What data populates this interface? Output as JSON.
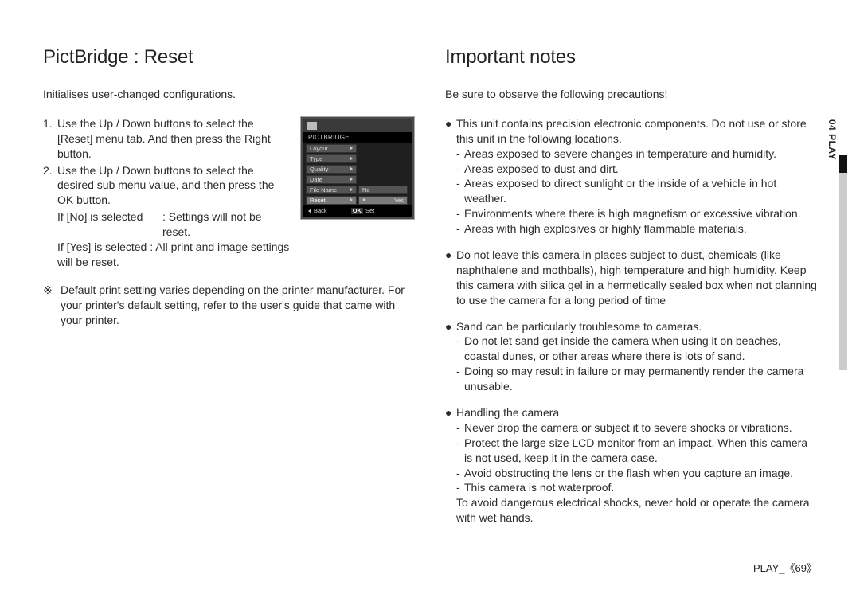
{
  "left": {
    "heading": "PictBridge : Reset",
    "intro": "Initialises user-changed configurations.",
    "steps": [
      "Use the Up / Down buttons to select the [Reset] menu tab. And then press the Right button.",
      "Use the Up / Down buttons to select the desired sub menu value, and then press the OK button."
    ],
    "ifno_label": "If [No] is selected",
    "ifno_val": ": Settings will not be reset.",
    "ifyes": "If [Yes] is selected : All print and image settings will be reset.",
    "note_sym": "※",
    "note": "Default print setting varies depending on the printer manufacturer. For your printer's default setting, refer to the user's guide that came with your printer."
  },
  "lcd": {
    "title": "PICTBRIDGE",
    "items": [
      "Layout",
      "Type",
      "Quality",
      "Date",
      "File Name",
      "Reset"
    ],
    "opts": [
      "No",
      "Yes"
    ],
    "back": "Back",
    "ok": "OK",
    "set": "Set"
  },
  "right": {
    "heading": "Important notes",
    "intro": "Be sure to observe the following precautions!",
    "g1_lead": "This unit contains precision electronic components. Do not use or store this unit in the following locations.",
    "g1_items": [
      "Areas exposed to severe changes in temperature and humidity.",
      "Areas exposed to dust and dirt.",
      "Areas exposed to direct sunlight or the inside of a vehicle in hot weather.",
      "Environments where there is high magnetism or excessive vibration.",
      "Areas with high explosives or highly flammable materials."
    ],
    "g2": "Do not leave this camera in places subject to dust, chemicals (like naphthalene and mothballs), high temperature and high humidity. Keep this camera with silica gel in a hermetically sealed box when not planning to use the camera for a long period of time",
    "g3_lead": "Sand can be particularly troublesome to cameras.",
    "g3_items": [
      "Do not let sand get inside the camera when using it on beaches, coastal dunes, or other areas where there is lots of sand.",
      "Doing so may result in failure or may permanently render the camera unusable."
    ],
    "g4_lead": "Handling the camera",
    "g4_items": [
      "Never drop the camera or subject it to severe shocks or vibrations.",
      "Protect  the large size LCD monitor from an impact. When this camera is not used, keep it in the camera case.",
      "Avoid obstructing the lens or the flash when you capture an image.",
      "This camera is not waterproof."
    ],
    "g4_tail": "To avoid dangerous electrical shocks, never hold or operate the camera with wet hands."
  },
  "sidetab": "04 PLAY",
  "footer_label": "PLAY_",
  "footer_open": "《",
  "footer_page": "69",
  "footer_close": "》"
}
